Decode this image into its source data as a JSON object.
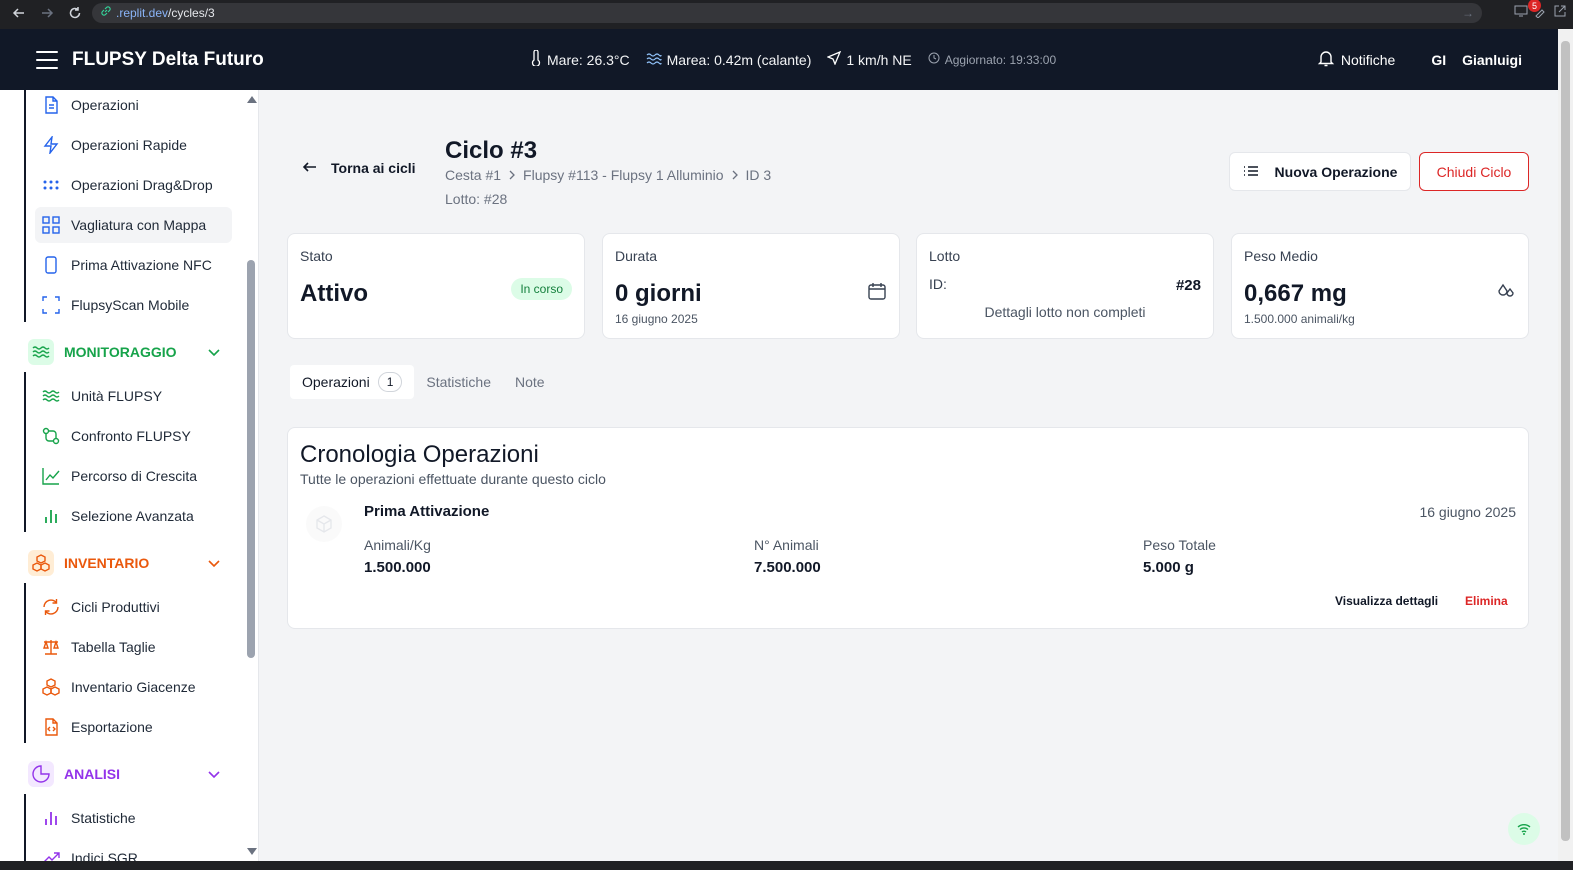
{
  "browser": {
    "url_domain": ".replit.dev",
    "url_path": "/cycles/3",
    "extensions_badge": "5"
  },
  "topbar": {
    "brand": "FLUPSY Delta Futuro",
    "sea_temp": "Mare: 26.3°C",
    "tide": "Marea: 0.42m (calante)",
    "wind": "1 km/h NE",
    "updated": "Aggiornato: 19:33:00",
    "notifications": "Notifiche",
    "user_initials": "GI",
    "user_name": "Gianluigi"
  },
  "sidebar": {
    "operations_items": [
      {
        "label": "Operazioni",
        "icon": "document-icon"
      },
      {
        "label": "Operazioni Rapide",
        "icon": "lightning-icon"
      },
      {
        "label": "Operazioni Drag&Drop",
        "icon": "grip-dots-icon"
      },
      {
        "label": "Vagliatura con Mappa",
        "icon": "grid-icon"
      },
      {
        "label": "Prima Attivazione NFC",
        "icon": "smartphone-icon"
      },
      {
        "label": "FlupsyScan Mobile",
        "icon": "scan-icon"
      }
    ],
    "monitoraggio": {
      "title": "MONITORAGGIO",
      "color": "#16a34a",
      "items": [
        {
          "label": "Unità FLUPSY",
          "icon": "waves-icon"
        },
        {
          "label": "Confronto FLUPSY",
          "icon": "git-compare-icon"
        },
        {
          "label": "Percorso di Crescita",
          "icon": "line-chart-icon"
        },
        {
          "label": "Selezione Avanzata",
          "icon": "bar-chart-icon"
        }
      ]
    },
    "inventario": {
      "title": "INVENTARIO",
      "color": "#ea580c",
      "items": [
        {
          "label": "Cicli Produttivi",
          "icon": "refresh-icon"
        },
        {
          "label": "Tabella Taglie",
          "icon": "scale-icon"
        },
        {
          "label": "Inventario Giacenze",
          "icon": "boxes-icon"
        },
        {
          "label": "Esportazione",
          "icon": "file-code-icon"
        }
      ]
    },
    "analisi": {
      "title": "ANALISI",
      "color": "#9333ea",
      "items": [
        {
          "label": "Statistiche",
          "icon": "bar-chart-icon"
        },
        {
          "label": "Indici SGR",
          "icon": "trending-up-icon"
        }
      ]
    }
  },
  "header": {
    "back_label": "Torna ai cicli",
    "title": "Ciclo #3",
    "breadcrumb": [
      "Cesta #1",
      "Flupsy #113 - Flupsy 1 Alluminio",
      "ID 3"
    ],
    "lotto": "Lotto: #28",
    "new_op_label": "Nuova Operazione",
    "close_label": "Chiudi Ciclo"
  },
  "cards": {
    "stato": {
      "label": "Stato",
      "value": "Attivo",
      "badge": "In corso"
    },
    "durata": {
      "label": "Durata",
      "value": "0 giorni",
      "sub": "16 giugno 2025"
    },
    "lotto": {
      "label": "Lotto",
      "id_label": "ID:",
      "id_value": "#28",
      "note": "Dettagli lotto non completi"
    },
    "peso": {
      "label": "Peso Medio",
      "value": "0,667 mg",
      "sub": "1.500.000 animali/kg"
    }
  },
  "tabs": [
    {
      "label": "Operazioni",
      "count": "1"
    },
    {
      "label": "Statistiche"
    },
    {
      "label": "Note"
    }
  ],
  "timeline": {
    "title": "Cronologia Operazioni",
    "description": "Tutte le operazioni effettuate durante questo ciclo",
    "operation": {
      "title": "Prima Attivazione",
      "date": "16 giugno 2025",
      "fields": [
        {
          "label": "Animali/Kg",
          "value": "1.500.000"
        },
        {
          "label": "N° Animali",
          "value": "7.500.000"
        },
        {
          "label": "Peso Totale",
          "value": "5.000 g"
        }
      ],
      "details_label": "Visualizza dettagli",
      "delete_label": "Elimina"
    }
  }
}
